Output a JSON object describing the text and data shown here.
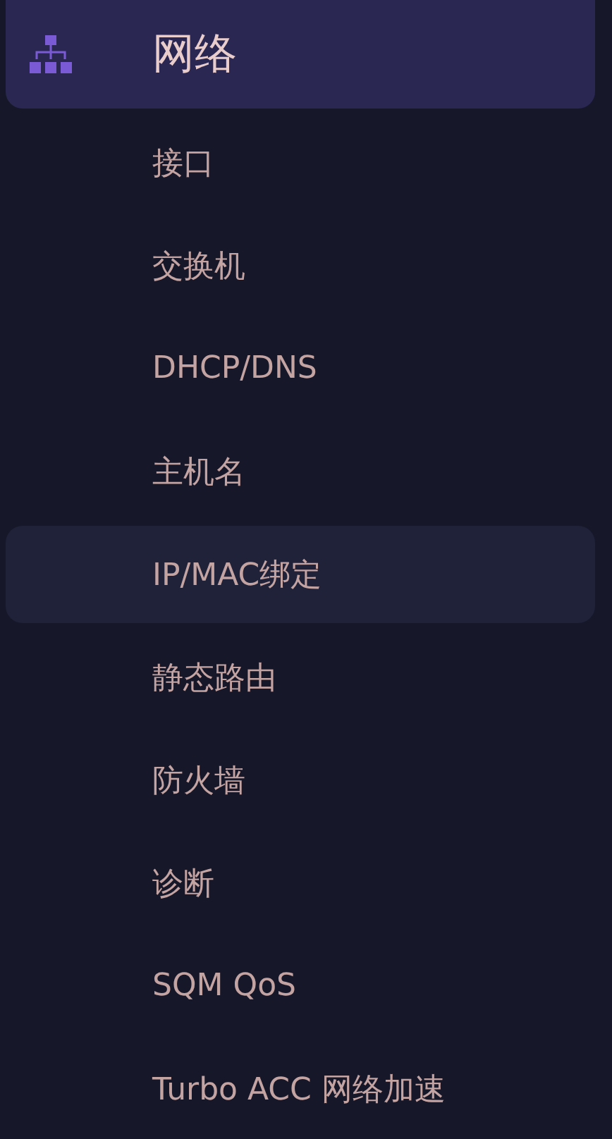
{
  "menu": {
    "title": "网络",
    "items": [
      {
        "label": "接口",
        "highlighted": false
      },
      {
        "label": "交换机",
        "highlighted": false
      },
      {
        "label": "DHCP/DNS",
        "highlighted": false
      },
      {
        "label": "主机名",
        "highlighted": false
      },
      {
        "label": "IP/MAC绑定",
        "highlighted": true
      },
      {
        "label": "静态路由",
        "highlighted": false
      },
      {
        "label": "防火墙",
        "highlighted": false
      },
      {
        "label": "诊断",
        "highlighted": false
      },
      {
        "label": "SQM QoS",
        "highlighted": false
      },
      {
        "label": "Turbo ACC 网络加速",
        "highlighted": false
      }
    ]
  }
}
